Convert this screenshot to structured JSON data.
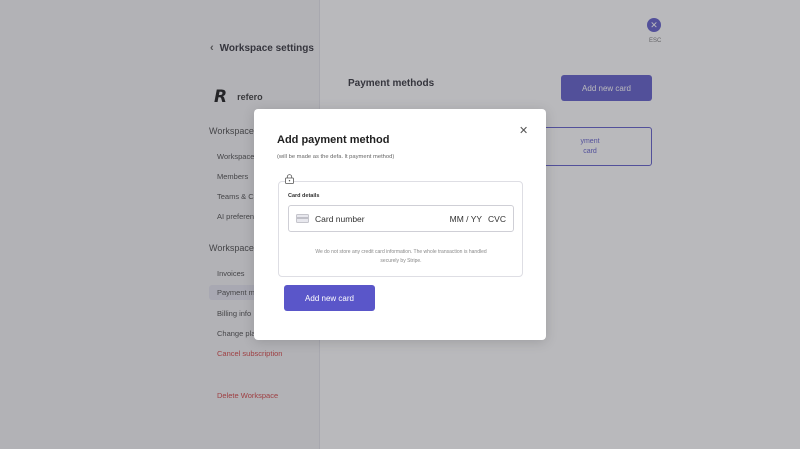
{
  "sidebar": {
    "back_label": "Workspace settings",
    "logo_mark": "R",
    "logo_name": "refero",
    "section1_title": "Workspace",
    "section1_items": [
      "Workspace",
      "Members",
      "Teams & C",
      "AI preferen"
    ],
    "section2_title": "Workspace",
    "section2_items": [
      "Invoices",
      "Payment m",
      "Billing info",
      "Change pla"
    ],
    "cancel_subscription": "Cancel subscription",
    "delete_workspace": "Delete Workspace"
  },
  "main": {
    "esc_label": "ESC",
    "payment_methods_title": "Payment methods",
    "add_new_card_label": "Add new card",
    "card_fragment_line1": "yment",
    "card_fragment_line2": "card"
  },
  "modal": {
    "title": "Add payment method",
    "subtitle": "(will be made as the defa. lt payment method)",
    "card_details_label": "Card details",
    "card_number_placeholder": "Card number",
    "expiry_placeholder": "MM / YY",
    "cvc_placeholder": "CVC",
    "secure_note_line1": "We do not store any credit card information. The whole transaction is handled",
    "secure_note_line2": "securely by Stripe.",
    "submit_label": "Add new card"
  },
  "colors": {
    "accent": "#5a56c9",
    "danger": "#d33a3a"
  }
}
